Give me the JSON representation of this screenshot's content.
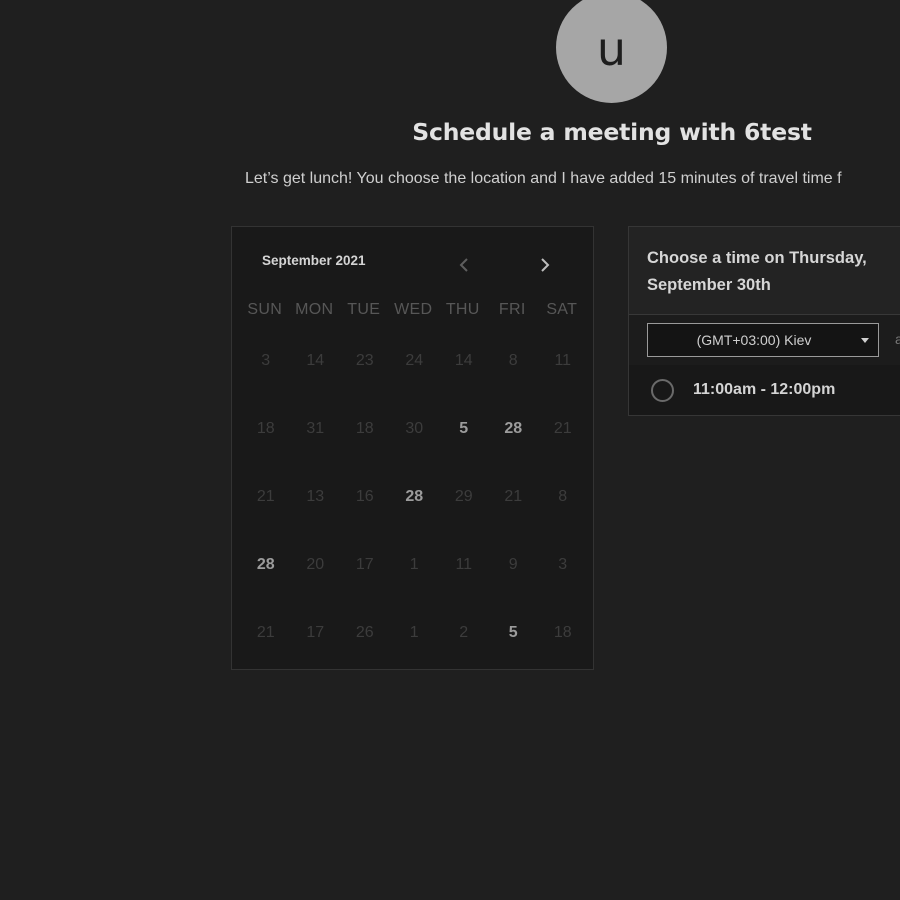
{
  "host": {
    "avatar_letter": "u",
    "title": "Schedule a meeting with 6test",
    "description": "Let’s get lunch! You choose the location and I have added 15 minutes of travel time f"
  },
  "calendar": {
    "month_label": "September 2021",
    "prev_icon": "chevron-left-icon",
    "next_icon": "chevron-right-icon",
    "weekdays": [
      "SUN",
      "MON",
      "TUE",
      "WED",
      "THU",
      "FRI",
      "SAT"
    ],
    "weeks": [
      [
        {
          "v": "3",
          "active": false
        },
        {
          "v": "14",
          "active": false
        },
        {
          "v": "23",
          "active": false
        },
        {
          "v": "24",
          "active": false
        },
        {
          "v": "14",
          "active": false
        },
        {
          "v": "8",
          "active": false
        },
        {
          "v": "11",
          "active": false
        }
      ],
      [
        {
          "v": "18",
          "active": false
        },
        {
          "v": "31",
          "active": false
        },
        {
          "v": "18",
          "active": false
        },
        {
          "v": "30",
          "active": false
        },
        {
          "v": "5",
          "active": true
        },
        {
          "v": "28",
          "active": true
        },
        {
          "v": "21",
          "active": false
        }
      ],
      [
        {
          "v": "21",
          "active": false
        },
        {
          "v": "13",
          "active": false
        },
        {
          "v": "16",
          "active": false
        },
        {
          "v": "28",
          "active": true
        },
        {
          "v": "29",
          "active": false
        },
        {
          "v": "21",
          "active": false
        },
        {
          "v": "8",
          "active": false
        }
      ],
      [
        {
          "v": "28",
          "active": true
        },
        {
          "v": "20",
          "active": false
        },
        {
          "v": "17",
          "active": false
        },
        {
          "v": "1",
          "active": false
        },
        {
          "v": "11",
          "active": false
        },
        {
          "v": "9",
          "active": false
        },
        {
          "v": "3",
          "active": false
        }
      ],
      [
        {
          "v": "21",
          "active": false
        },
        {
          "v": "17",
          "active": false
        },
        {
          "v": "26",
          "active": false
        },
        {
          "v": "1",
          "active": false
        },
        {
          "v": "2",
          "active": false
        },
        {
          "v": "5",
          "active": true
        },
        {
          "v": "18",
          "active": false
        }
      ]
    ]
  },
  "time_panel": {
    "heading": "Choose a time on Thursday, September 30th",
    "timezone": "(GMT+03:00) Kiev",
    "timezone_icon": "caret-down-icon",
    "side_text": "a",
    "slots": [
      {
        "label": "11:00am - 12:00pm",
        "selected": false
      }
    ]
  },
  "colors": {
    "background": "#1f1f1f",
    "avatar": "#a6a6a6",
    "calendar_bg": "#191919",
    "panel_header_bg": "#232323"
  }
}
